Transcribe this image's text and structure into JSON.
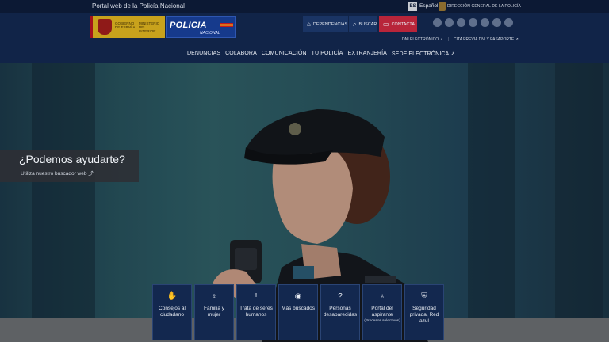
{
  "topbar": {
    "site_title": "Portal web de la Policía Nacional",
    "lang_code": "ES",
    "lang_name": "Español",
    "directorate": "DIRECCIÓN GENERAL DE LA POLICÍA"
  },
  "header": {
    "gov_logo_line1": "GOBIERNO DE ESPAÑA",
    "gov_logo_line2": "MINISTERIO DEL INTERIOR",
    "pn_logo_title": "POLICIA",
    "pn_logo_sub": "NACIONAL",
    "buttons": {
      "dependencias": "DEPENDENCIAS",
      "buscar": "BUSCAR",
      "contacta": "CONTACTA"
    },
    "sublinks": [
      "DNI ELECTRÓNICO ↗",
      "CITA PREVIA DNI Y PASAPORTE ↗"
    ],
    "nav": [
      "DENUNCIAS",
      "COLABORA",
      "COMUNICACIÓN",
      "TU POLICÍA",
      "EXTRANJERÍA",
      "SEDE ELECTRÓNICA ↗"
    ]
  },
  "hero": {
    "help_title": "¿Podemos ayudarte?",
    "help_sub": "Utiliza nuestro buscador web ⤴"
  },
  "cards": [
    {
      "icon": "✋",
      "label": "Consejos al ciudadano",
      "sub": ""
    },
    {
      "icon": "♀",
      "label": "Familia y mujer",
      "sub": ""
    },
    {
      "icon": "!",
      "label": "Trata de seres humanos",
      "sub": ""
    },
    {
      "icon": "◉",
      "label": "Más buscados",
      "sub": ""
    },
    {
      "icon": "?",
      "label": "Personas desaparecidas",
      "sub": ""
    },
    {
      "icon": "♁",
      "label": "Portal del aspirante",
      "sub": "(Procesos selectivos)"
    },
    {
      "icon": "⛨",
      "label": "Seguridad privada, Red azul",
      "sub": ""
    }
  ]
}
